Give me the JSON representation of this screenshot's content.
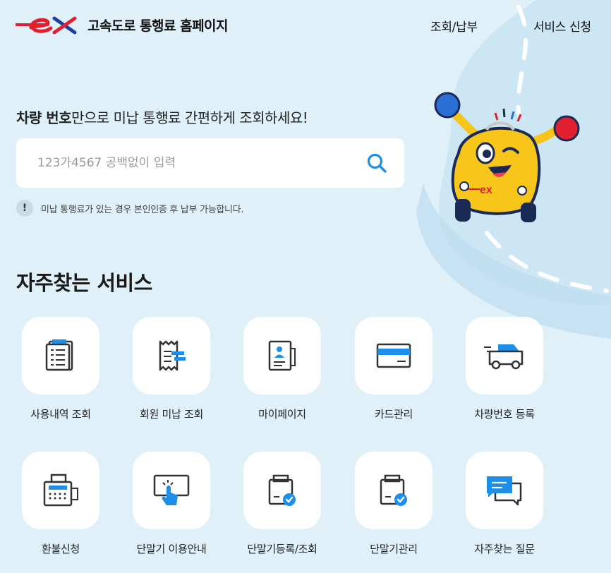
{
  "header": {
    "site_title": "고속도로 통행료 홈페이지",
    "nav": [
      "조회/납부",
      "서비스 신청"
    ]
  },
  "hero": {
    "headline_bold": "차량 번호",
    "headline_rest": "만으로 미납 통행료 간편하게 조회하세요!",
    "search_placeholder": "123가4567 공백없이 입력",
    "search_value": "",
    "notice": "미납 통행료가 있는 경우 본인인증 후 납부 가능합니다."
  },
  "services": {
    "title": "자주찾는 서비스",
    "items": [
      {
        "label": "사용내역 조회",
        "icon": "document-list-icon"
      },
      {
        "label": "회원 미납 조회",
        "icon": "receipt-icon"
      },
      {
        "label": "마이페이지",
        "icon": "profile-card-icon"
      },
      {
        "label": "카드관리",
        "icon": "credit-card-icon"
      },
      {
        "label": "차량번호 등록",
        "icon": "car-icon"
      },
      {
        "label": "환불신청",
        "icon": "cash-register-icon"
      },
      {
        "label": "단말기 이용안내",
        "icon": "touch-screen-icon"
      },
      {
        "label": "단말기등록/조회",
        "icon": "device-check-icon"
      },
      {
        "label": "단말기관리",
        "icon": "device-check-icon"
      },
      {
        "label": "자주찾는 질문",
        "icon": "chat-bubbles-icon"
      }
    ]
  },
  "colors": {
    "brand_red": "#e0202e",
    "brand_blue": "#1a3fa0",
    "accent_blue": "#1e8fe8",
    "background": "#dff0f8"
  }
}
